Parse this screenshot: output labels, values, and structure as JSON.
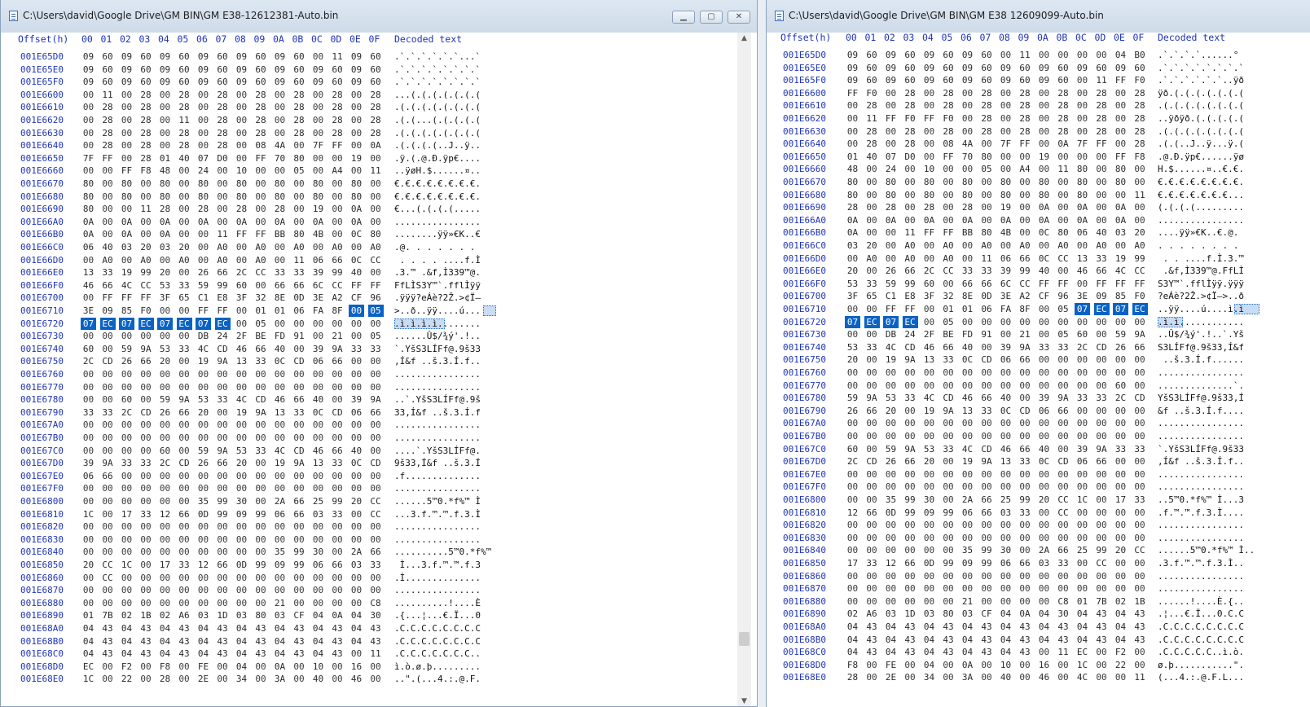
{
  "left": {
    "title": "C:\\Users\\david\\Google Drive\\GM BIN\\GM E38-12612381-Auto.bin",
    "header": {
      "offset": "Offset(h)",
      "cols": [
        "00",
        "01",
        "02",
        "03",
        "04",
        "05",
        "06",
        "07",
        "08",
        "09",
        "0A",
        "0B",
        "0C",
        "0D",
        "0E",
        "0F"
      ],
      "decoded": "Decoded text"
    },
    "rows": [
      {
        "o": "001E65D0",
        "b": "09 60 09 60 09 60 09 60 09 60 09 60 00 11 09 60",
        "t": ".`.`.`.`.`.`...`"
      },
      {
        "o": "001E65E0",
        "b": "09 60 09 60 09 60 09 60 09 60 09 60 09 60 09 60",
        "t": ".`.`.`.`.`.`.`.`"
      },
      {
        "o": "001E65F0",
        "b": "09 60 09 60 09 60 09 60 09 60 09 60 09 60 09 60",
        "t": ".`.`.`.`.`.`.`.`"
      },
      {
        "o": "001E6600",
        "b": "00 11 00 28 00 28 00 28 00 28 00 28 00 28 00 28",
        "t": "...(.(.(.(.(.(.("
      },
      {
        "o": "001E6610",
        "b": "00 28 00 28 00 28 00 28 00 28 00 28 00 28 00 28",
        "t": ".(.(.(.(.(.(.(.("
      },
      {
        "o": "001E6620",
        "b": "00 28 00 28 00 11 00 28 00 28 00 28 00 28 00 28",
        "t": ".(.(...(.(.(.(.("
      },
      {
        "o": "001E6630",
        "b": "00 28 00 28 00 28 00 28 00 28 00 28 00 28 00 28",
        "t": ".(.(.(.(.(.(.(.("
      },
      {
        "o": "001E6640",
        "b": "00 28 00 28 00 28 00 28 00 08 4A 00 7F FF 00 0A",
        "t": ".(.(.(.(..J..ÿ.."
      },
      {
        "o": "001E6650",
        "b": "7F FF 00 28 01 40 07 D0 00 FF 70 80 00 00 19 00",
        "t": ".ÿ.(.@.Ð.ÿp€...."
      },
      {
        "o": "001E6660",
        "b": "00 00 FF F8 48 00 24 00 10 00 00 05 00 A4 00 11",
        "t": "..ÿøH.$......¤.."
      },
      {
        "o": "001E6670",
        "b": "80 00 80 00 80 00 80 00 80 00 80 00 80 00 80 00",
        "t": "€.€.€.€.€.€.€.€."
      },
      {
        "o": "001E6680",
        "b": "80 00 80 00 80 00 80 00 80 00 80 00 80 00 80 00",
        "t": "€.€.€.€.€.€.€.€."
      },
      {
        "o": "001E6690",
        "b": "80 00 00 11 28 00 28 00 28 00 28 00 19 00 0A 00",
        "t": "€...(.(.(.(....."
      },
      {
        "o": "001E66A0",
        "b": "0A 00 0A 00 0A 00 0A 00 0A 00 0A 00 0A 00 0A 00",
        "t": "................"
      },
      {
        "o": "001E66B0",
        "b": "0A 00 0A 00 0A 00 00 11 FF FF BB 80 4B 00 0C 80",
        "t": "........ÿÿ»€K..€"
      },
      {
        "o": "001E66C0",
        "b": "06 40 03 20 03 20 00 A0 00 A0 00 A0 00 A0 00 A0",
        "t": ".@. . . . . . . "
      },
      {
        "o": "001E66D0",
        "b": "00 A0 00 A0 00 A0 00 A0 00 A0 00 11 06 66 0C CC",
        "t": " . . . . ....f.Ì"
      },
      {
        "o": "001E66E0",
        "b": "13 33 19 99 20 00 26 66 2C CC 33 33 39 99 40 00",
        "t": ".3.™ .&f,Ì339™@."
      },
      {
        "o": "001E66F0",
        "b": "46 66 4C CC 53 33 59 99 60 00 66 66 6C CC FF FF",
        "t": "FfLÌS3Y™`.fflÌÿÿ"
      },
      {
        "o": "001E6700",
        "b": "00 FF FF FF 3F 65 C1 E8 3F 32 8E 0D 3E A2 CF 96",
        "t": ".ÿÿÿ?eÁè?2Ž.>¢Ï–"
      },
      {
        "o": "001E6710",
        "b": "3E 09 85 F0 00 00 FF FF 00 01 01 06 FA 8F 00 05",
        "t": ">..ð..ÿÿ....ú..."
      },
      {
        "o": "001E6720",
        "b": "07 EC 07 EC 07 EC 07 EC 00 05 00 00 00 00 00 00",
        "t": ".ì.ì.ì.ì........"
      },
      {
        "o": "001E6730",
        "b": "00 00 00 00 00 00 DB 24 2F BE FD 91 00 21 00 05",
        "t": "......Û$/¾ý'.!.."
      },
      {
        "o": "001E6740",
        "b": "60 00 59 9A 53 33 4C CD 46 66 40 00 39 9A 33 33",
        "t": "`.YšS3LÍFf@.9š33"
      },
      {
        "o": "001E6750",
        "b": "2C CD 26 66 20 00 19 9A 13 33 0C CD 06 66 00 00",
        "t": ",Í&f ..š.3.Í.f.."
      },
      {
        "o": "001E6760",
        "b": "00 00 00 00 00 00 00 00 00 00 00 00 00 00 00 00",
        "t": "................"
      },
      {
        "o": "001E6770",
        "b": "00 00 00 00 00 00 00 00 00 00 00 00 00 00 00 00",
        "t": "................"
      },
      {
        "o": "001E6780",
        "b": "00 00 60 00 59 9A 53 33 4C CD 46 66 40 00 39 9A",
        "t": "..`.YšS3LÍFf@.9š"
      },
      {
        "o": "001E6790",
        "b": "33 33 2C CD 26 66 20 00 19 9A 13 33 0C CD 06 66",
        "t": "33,Í&f ..š.3.Í.f"
      },
      {
        "o": "001E67A0",
        "b": "00 00 00 00 00 00 00 00 00 00 00 00 00 00 00 00",
        "t": "................"
      },
      {
        "o": "001E67B0",
        "b": "00 00 00 00 00 00 00 00 00 00 00 00 00 00 00 00",
        "t": "................"
      },
      {
        "o": "001E67C0",
        "b": "00 00 00 00 60 00 59 9A 53 33 4C CD 46 66 40 00",
        "t": "....`.YšS3LÍFf@."
      },
      {
        "o": "001E67D0",
        "b": "39 9A 33 33 2C CD 26 66 20 00 19 9A 13 33 0C CD",
        "t": "9š33,Í&f ..š.3.Í"
      },
      {
        "o": "001E67E0",
        "b": "06 66 00 00 00 00 00 00 00 00 00 00 00 00 00 00",
        "t": ".f.............."
      },
      {
        "o": "001E67F0",
        "b": "00 00 00 00 00 00 00 00 00 00 00 00 00 00 00 00",
        "t": "................"
      },
      {
        "o": "001E6800",
        "b": "00 00 00 00 00 00 35 99 30 00 2A 66 25 99 20 CC",
        "t": "......5™0.*f%™ Ì"
      },
      {
        "o": "001E6810",
        "b": "1C 00 17 33 12 66 0D 99 09 99 06 66 03 33 00 CC",
        "t": "...3.f.™.™.f.3.Ì"
      },
      {
        "o": "001E6820",
        "b": "00 00 00 00 00 00 00 00 00 00 00 00 00 00 00 00",
        "t": "................"
      },
      {
        "o": "001E6830",
        "b": "00 00 00 00 00 00 00 00 00 00 00 00 00 00 00 00",
        "t": "................"
      },
      {
        "o": "001E6840",
        "b": "00 00 00 00 00 00 00 00 00 00 35 99 30 00 2A 66 25 99",
        "t": "..........5™0.*f%™"
      },
      {
        "o": "001E6850",
        "b": "20 CC 1C 00 17 33 12 66 0D 99 09 99 06 66 03 33",
        "t": " Ì...3.f.™.™.f.3"
      },
      {
        "o": "001E6860",
        "b": "00 CC 00 00 00 00 00 00 00 00 00 00 00 00 00 00",
        "t": ".Ì.............."
      },
      {
        "o": "001E6870",
        "b": "00 00 00 00 00 00 00 00 00 00 00 00 00 00 00 00",
        "t": "................"
      },
      {
        "o": "001E6880",
        "b": "00 00 00 00 00 00 00 00 00 00 21 00 00 00 00 C8",
        "t": "..........!....È"
      },
      {
        "o": "001E6890",
        "b": "01 7B 02 1B 02 A6 03 1D 03 80 03 CF 04 0A 04 30",
        "t": ".{...¦...€.Ï...0"
      },
      {
        "o": "001E68A0",
        "b": "04 43 04 43 04 43 04 43 04 43 04 43 04 43 04 43",
        "t": ".C.C.C.C.C.C.C.C"
      },
      {
        "o": "001E68B0",
        "b": "04 43 04 43 04 43 04 43 04 43 04 43 04 43 04 43",
        "t": ".C.C.C.C.C.C.C.C"
      },
      {
        "o": "001E68C0",
        "b": "04 43 04 43 04 43 04 43 04 43 04 43 04 43 00 11",
        "t": ".C.C.C.C.C.C.C.."
      },
      {
        "o": "001E68D0",
        "b": "EC 00 F2 00 F8 00 FE 00 04 00 0A 00 10 00 16 00",
        "t": "ì.ò.ø.þ........."
      },
      {
        "o": "001E68E0",
        "b": "1C 00 22 00 28 00 2E 00 34 00 3A 00 40 00 46 00",
        "t": "..\".(...4.:.@.F."
      }
    ]
  },
  "right": {
    "title": "C:\\Users\\david\\Google Drive\\GM BIN\\GM E38 12609099-Auto.bin",
    "header": {
      "offset": "Offset(h)",
      "cols": [
        "00",
        "01",
        "02",
        "03",
        "04",
        "05",
        "06",
        "07",
        "08",
        "09",
        "0A",
        "0B",
        "0C",
        "0D",
        "0E",
        "0F"
      ],
      "decoded": "Decoded text"
    },
    "rows": [
      {
        "o": "001E65D0",
        "b": "09 60 09 60 09 60 09 60 00 11 00 00 00 00 04 B0",
        "t": ".`.`.`.`......°"
      },
      {
        "o": "001E65E0",
        "b": "09 60 09 60 09 60 09 60 09 60 09 60 09 60 09 60",
        "t": ".`.`.`.`.`.`.`.`"
      },
      {
        "o": "001E65F0",
        "b": "09 60 09 60 09 60 09 60 09 60 09 60 00 11 FF F0",
        "t": ".`.`.`.`.`.`..ÿð"
      },
      {
        "o": "001E6600",
        "b": "FF F0 00 28 00 28 00 28 00 28 00 28 00 28 00 28",
        "t": "ÿð.(.(.(.(.(.(.("
      },
      {
        "o": "001E6610",
        "b": "00 28 00 28 00 28 00 28 00 28 00 28 00 28 00 28",
        "t": ".(.(.(.(.(.(.(.("
      },
      {
        "o": "001E6620",
        "b": "00 11 FF F0 FF F0 00 28 00 28 00 28 00 28 00 28",
        "t": "..ÿðÿð.(.(.(.(.("
      },
      {
        "o": "001E6630",
        "b": "00 28 00 28 00 28 00 28 00 28 00 28 00 28 00 28",
        "t": ".(.(.(.(.(.(.(.("
      },
      {
        "o": "001E6640",
        "b": "00 28 00 28 00 08 4A 00 7F FF 00 0A 7F FF 00 28",
        "t": ".(.(..J..ÿ...ÿ.("
      },
      {
        "o": "001E6650",
        "b": "01 40 07 D0 00 FF 70 80 00 00 19 00 00 00 FF F8",
        "t": ".@.Ð.ÿp€......ÿø"
      },
      {
        "o": "001E6660",
        "b": "48 00 24 00 10 00 00 05 00 A4 00 11 80 00 80 00",
        "t": "H.$......¤..€.€."
      },
      {
        "o": "001E6670",
        "b": "80 00 80 00 80 00 80 00 80 00 80 00 80 00 80 00",
        "t": "€.€.€.€.€.€.€.€."
      },
      {
        "o": "001E6680",
        "b": "80 00 80 00 80 00 80 00 80 00 80 00 80 00 00 11",
        "t": "€.€.€.€.€.€.€..."
      },
      {
        "o": "001E6690",
        "b": "28 00 28 00 28 00 28 00 19 00 0A 00 0A 00 0A 00",
        "t": "(.(.(.(........."
      },
      {
        "o": "001E66A0",
        "b": "0A 00 0A 00 0A 00 0A 00 0A 00 0A 00 0A 00 0A 00",
        "t": "................"
      },
      {
        "o": "001E66B0",
        "b": "0A 00 00 11 FF FF BB 80 4B 00 0C 80 06 40 03 20",
        "t": "....ÿÿ»€K..€.@. "
      },
      {
        "o": "001E66C0",
        "b": "03 20 00 A0 00 A0 00 A0 00 A0 00 A0 00 A0 00 A0",
        "t": ". . . . . . . . "
      },
      {
        "o": "001E66D0",
        "b": "00 A0 00 A0 00 A0 00 11 06 66 0C CC 13 33 19 99",
        "t": " . . ....f.Ì.3.™"
      },
      {
        "o": "001E66E0",
        "b": "20 00 26 66 2C CC 33 33 39 99 40 00 46 66 4C CC",
        "t": " .&f,Ì339™@.FfLÌ"
      },
      {
        "o": "001E66F0",
        "b": "53 33 59 99 60 00 66 66 6C CC FF FF 00 FF FF FF",
        "t": "S3Y™`.fflÌÿÿ.ÿÿÿ"
      },
      {
        "o": "001E6700",
        "b": "3F 65 C1 E8 3F 32 8E 0D 3E A2 CF 96 3E 09 85 F0",
        "t": "?eÁè?2Ž.>¢Ï–>..ð"
      },
      {
        "o": "001E6710",
        "b": "00 00 FF FF 00 01 01 06 FA 8F 00 05 07 EC 07 EC",
        "t": "..ÿÿ....ú....ì.ì"
      },
      {
        "o": "001E6720",
        "b": "07 EC 07 EC 00 05 00 00 00 00 00 00 00 00 00 00",
        "t": ".ì.ì............"
      },
      {
        "o": "001E6730",
        "b": "00 00 DB 24 2F BE FD 91 00 21 00 05 60 00 59 9A",
        "t": "..Û$/¾ý'.!..`.Yš"
      },
      {
        "o": "001E6740",
        "b": "53 33 4C CD 46 66 40 00 39 9A 33 33 2C CD 26 66",
        "t": "S3LÍFf@.9š33,Í&f"
      },
      {
        "o": "001E6750",
        "b": "20 00 19 9A 13 33 0C CD 06 66 00 00 00 00 00 00",
        "t": " ..š.3.Í.f......"
      },
      {
        "o": "001E6760",
        "b": "00 00 00 00 00 00 00 00 00 00 00 00 00 00 00 00",
        "t": "................"
      },
      {
        "o": "001E6770",
        "b": "00 00 00 00 00 00 00 00 00 00 00 00 00 00 60 00",
        "t": "..............`."
      },
      {
        "o": "001E6780",
        "b": "59 9A 53 33 4C CD 46 66 40 00 39 9A 33 33 2C CD",
        "t": "YšS3LÍFf@.9š33,Í"
      },
      {
        "o": "001E6790",
        "b": "26 66 20 00 19 9A 13 33 0C CD 06 66 00 00 00 00",
        "t": "&f ..š.3.Í.f...."
      },
      {
        "o": "001E67A0",
        "b": "00 00 00 00 00 00 00 00 00 00 00 00 00 00 00 00",
        "t": "................"
      },
      {
        "o": "001E67B0",
        "b": "00 00 00 00 00 00 00 00 00 00 00 00 00 00 00 00",
        "t": "................"
      },
      {
        "o": "001E67C0",
        "b": "60 00 59 9A 53 33 4C CD 46 66 40 00 39 9A 33 33",
        "t": "`.YšS3LÍFf@.9š33"
      },
      {
        "o": "001E67D0",
        "b": "2C CD 26 66 20 00 19 9A 13 33 0C CD 06 66 00 00",
        "t": ",Í&f ..š.3.Í.f.."
      },
      {
        "o": "001E67E0",
        "b": "00 00 00 00 00 00 00 00 00 00 00 00 00 00 00 00",
        "t": "................"
      },
      {
        "o": "001E67F0",
        "b": "00 00 00 00 00 00 00 00 00 00 00 00 00 00 00 00",
        "t": "................"
      },
      {
        "o": "001E6800",
        "b": "00 00 35 99 30 00 2A 66 25 99 20 CC 1C 00 17 33",
        "t": "..5™0.*f%™ Ì...3"
      },
      {
        "o": "001E6810",
        "b": "12 66 0D 99 09 99 06 66 03 33 00 CC 00 00 00 00",
        "t": ".f.™.™.f.3.Ì...."
      },
      {
        "o": "001E6820",
        "b": "00 00 00 00 00 00 00 00 00 00 00 00 00 00 00 00",
        "t": "................"
      },
      {
        "o": "001E6830",
        "b": "00 00 00 00 00 00 00 00 00 00 00 00 00 00 00 00",
        "t": "................"
      },
      {
        "o": "001E6840",
        "b": "00 00 00 00 00 00 35 99 30 00 2A 66 25 99 20 CC 1C 00",
        "t": "......5™0.*f%™ Ì.."
      },
      {
        "o": "001E6850",
        "b": "17 33 12 66 0D 99 09 99 06 66 03 33 00 CC 00 00",
        "t": ".3.f.™.™.f.3.Ì.."
      },
      {
        "o": "001E6860",
        "b": "00 00 00 00 00 00 00 00 00 00 00 00 00 00 00 00",
        "t": "................"
      },
      {
        "o": "001E6870",
        "b": "00 00 00 00 00 00 00 00 00 00 00 00 00 00 00 00",
        "t": "................"
      },
      {
        "o": "001E6880",
        "b": "00 00 00 00 00 00 21 00 00 00 00 C8 01 7B 02 1B",
        "t": "......!....È.{.."
      },
      {
        "o": "001E6890",
        "b": "02 A6 03 1D 03 80 03 CF 04 0A 04 30 04 43 04 43",
        "t": ".¦...€.Ï...0.C.C"
      },
      {
        "o": "001E68A0",
        "b": "04 43 04 43 04 43 04 43 04 43 04 43 04 43 04 43",
        "t": ".C.C.C.C.C.C.C.C"
      },
      {
        "o": "001E68B0",
        "b": "04 43 04 43 04 43 04 43 04 43 04 43 04 43 04 43",
        "t": ".C.C.C.C.C.C.C.C"
      },
      {
        "o": "001E68C0",
        "b": "04 43 04 43 04 43 04 43 04 43 00 11 EC 00 F2 00",
        "t": ".C.C.C.C.C..ì.ò."
      },
      {
        "o": "001E68D0",
        "b": "F8 00 FE 00 04 00 0A 00 10 00 16 00 1C 00 22 00",
        "t": "ø.þ...........\"."
      },
      {
        "o": "001E68E0",
        "b": "28 00 2E 00 34 00 3A 00 40 00 46 00 4C 00 00 11",
        "t": "(...4.:.@.F.L..."
      }
    ]
  },
  "icons": {
    "minimize": "minimize-icon",
    "maximize": "maximize-icon",
    "close": "close-icon"
  }
}
